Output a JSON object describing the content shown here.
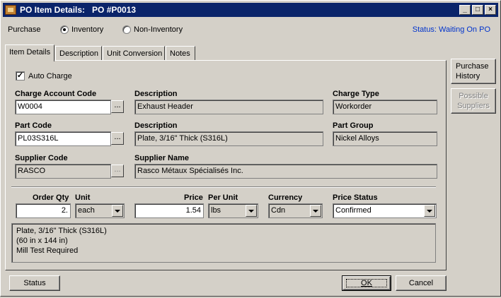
{
  "window": {
    "title": "PO Item Details:   PO #P0013",
    "controls": {
      "minimize": "_",
      "maximize": "□",
      "close": "×"
    }
  },
  "purchase": {
    "label": "Purchase",
    "inventory_label": "Inventory",
    "non_inventory_label": "Non-Inventory",
    "selected": "Inventory",
    "status": "Status: Waiting On PO"
  },
  "tabs": [
    {
      "label": "Item Details",
      "active": true
    },
    {
      "label": "Description"
    },
    {
      "label": "Unit Conversion"
    },
    {
      "label": "Notes"
    }
  ],
  "details": {
    "auto_charge_label": "Auto Charge",
    "auto_charge_checked": true,
    "charge_account_code_label": "Charge Account Code",
    "charge_account_code": "W0004",
    "description_label": "Description",
    "charge_description": "Exhaust Header",
    "charge_type_label": "Charge Type",
    "charge_type": "Workorder",
    "part_code_label": "Part Code",
    "part_code": "PL03S316L",
    "part_description_label": "Description",
    "part_description": "Plate, 3/16\" Thick (S316L)",
    "part_group_label": "Part Group",
    "part_group": "Nickel Alloys",
    "supplier_code_label": "Supplier Code",
    "supplier_code": "RASCO",
    "supplier_name_label": "Supplier Name",
    "supplier_name": "Rasco Métaux Spécialisés Inc.",
    "ellipsis": "...",
    "order_qty_label": "Order Qty",
    "order_qty": "2.",
    "unit_label": "Unit",
    "unit": "each",
    "price_label": "Price",
    "price": "1.54",
    "per_unit_label": "Per Unit",
    "per_unit": "lbs",
    "currency_label": "Currency",
    "currency": "Cdn",
    "price_status_label": "Price Status",
    "price_status": "Confirmed",
    "notes_lines": [
      "Plate, 3/16\" Thick (S316L)",
      "(60 in x 144 in)",
      "Mill Test Required"
    ]
  },
  "side_buttons": {
    "purchase_history_line1": "Purchase",
    "purchase_history_line2": "History",
    "possible_suppliers_line1": "Possible",
    "possible_suppliers_line2": "Suppliers"
  },
  "footer": {
    "status_button": "Status",
    "ok_button": "OK",
    "cancel_button": "Cancel"
  }
}
